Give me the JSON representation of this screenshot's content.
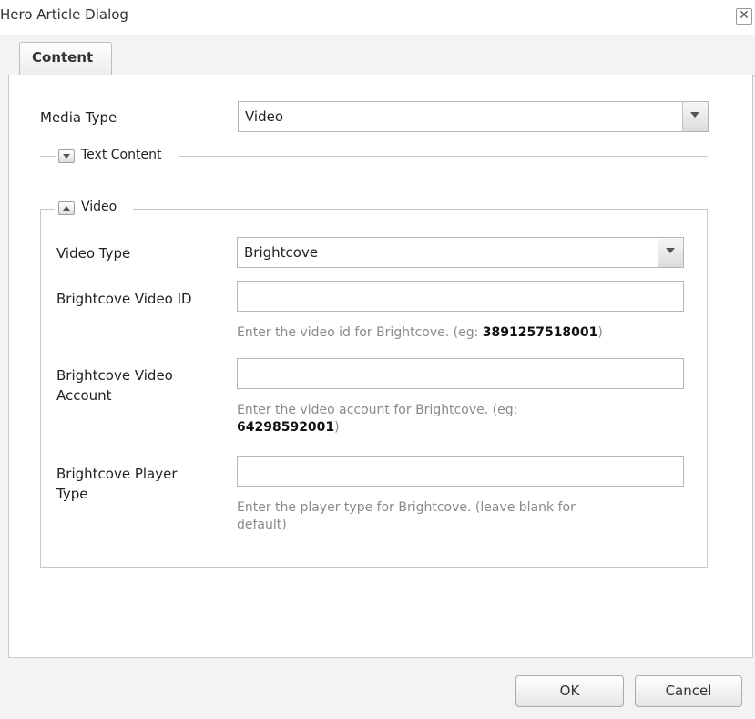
{
  "dialog": {
    "title": "Hero Article Dialog",
    "close_glyph": "✕"
  },
  "tabs": [
    {
      "label": "Content",
      "active": true
    }
  ],
  "form": {
    "media_type": {
      "label": "Media Type",
      "value": "Video"
    },
    "text_content_section": {
      "label": "Text Content",
      "collapsed": true
    },
    "video_section": {
      "label": "Video",
      "collapsed": false,
      "video_type": {
        "label": "Video Type",
        "value": "Brightcove"
      },
      "video_id": {
        "label": "Brightcove Video ID",
        "value": "",
        "hint_prefix": "Enter the video id for Brightcove. (eg: ",
        "hint_example": "3891257518001",
        "hint_suffix": ")"
      },
      "video_account": {
        "label_line1": "Brightcove Video",
        "label_line2": "Account",
        "value": "",
        "hint_prefix": "Enter the video account for Brightcove. (eg:",
        "hint_example": "64298592001",
        "hint_suffix": ")"
      },
      "player_type": {
        "label_line1": "Brightcove Player",
        "label_line2": "Type",
        "value": "",
        "hint_line1": "Enter the player type for Brightcove. (leave blank for",
        "hint_line2": "default)"
      }
    }
  },
  "footer": {
    "ok_label": "OK",
    "cancel_label": "Cancel"
  },
  "icons": {
    "dropdown": "chevron-down-icon",
    "collapsed": "expand-arrow-down-icon",
    "expanded": "collapse-arrow-up-icon"
  }
}
